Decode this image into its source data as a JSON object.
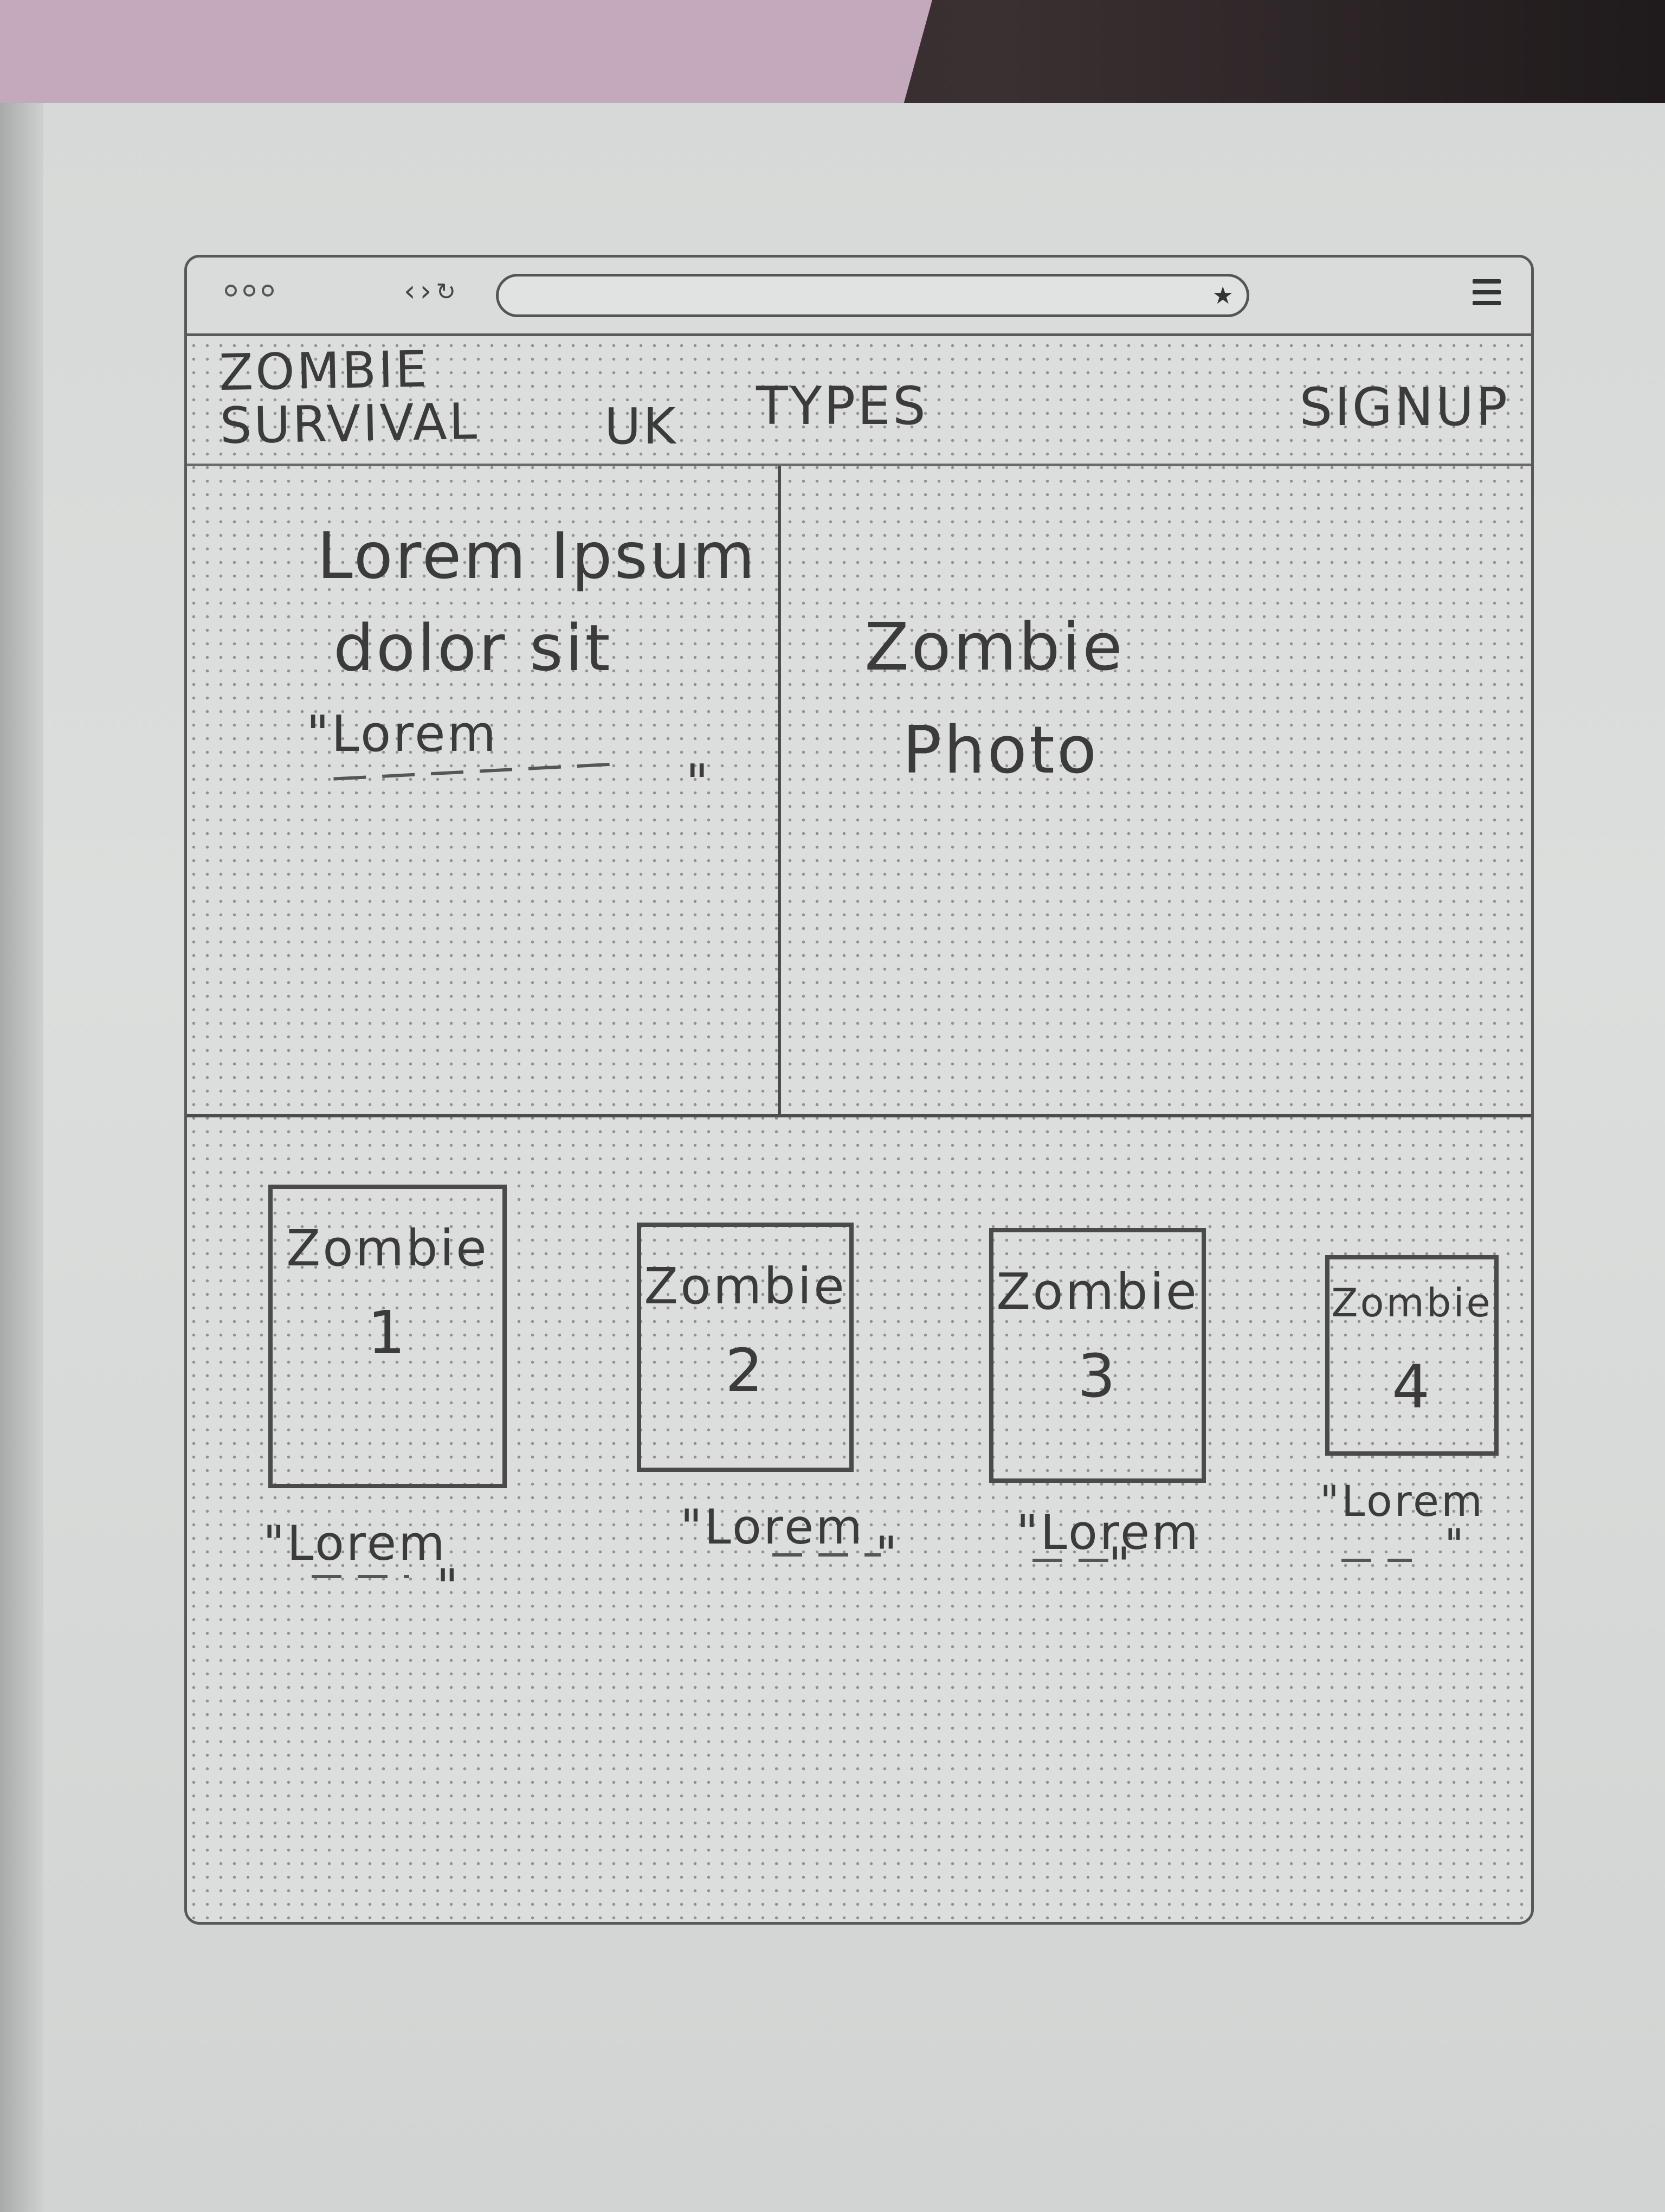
{
  "browser": {
    "window_controls": [
      "close",
      "minimize",
      "maximize"
    ],
    "nav_icons": {
      "back": "‹",
      "forward": "›",
      "reload": "↻"
    },
    "url": "",
    "bookmark_icon": "star-icon",
    "menu_icon": "hamburger-menu-icon"
  },
  "header": {
    "logo_line1": "ZOMBIE",
    "logo_line2": "SURVIVAL",
    "nav_uk": "UK",
    "nav_types": "TYPES",
    "signup": "SIGNUP"
  },
  "hero": {
    "heading_line1": "Lorem Ipsum",
    "heading_line2": "dolor sit",
    "quote": "\"Lorem",
    "quote_end": "\"",
    "photo_line1": "Zombie",
    "photo_line2": "Photo"
  },
  "cards": [
    {
      "title": "Zombie",
      "number": "1",
      "caption": "\"Lorem",
      "caption_end": "\""
    },
    {
      "title": "Zombie",
      "number": "2",
      "caption": "\"Lorem",
      "caption_end": "\""
    },
    {
      "title": "Zombie",
      "number": "3",
      "caption": "\"Lorem",
      "caption_end": "\""
    },
    {
      "title": "Zombie",
      "number": "4",
      "caption": "\"Lorem",
      "caption_end": "\""
    }
  ]
}
